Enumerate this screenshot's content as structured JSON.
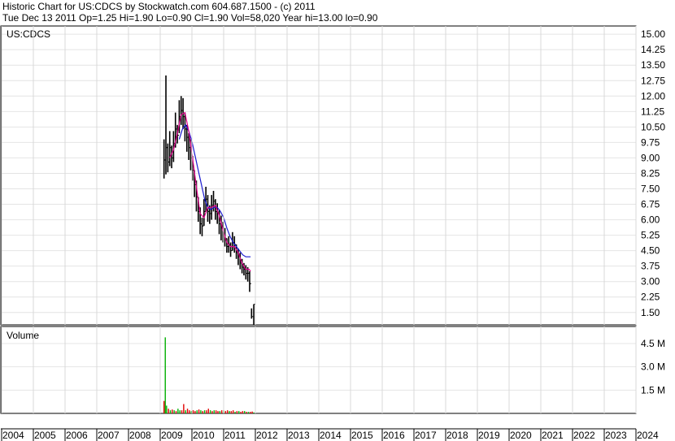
{
  "header": {
    "line1": "Historic Chart for US:CDCS by Stockwatch.com 604.687.1500 - (c) 2011",
    "line2": "Tue Dec 13 2011   Op=1.25  Hi=1.90  Lo=0.90  Cl=1.90  Vol=58,020  Year hi=13.00  lo=0.90"
  },
  "chart_data": [
    {
      "type": "line",
      "title": "US:CDCS",
      "ylim": [
        0.9,
        15.4
      ],
      "yticks": [
        "15.00",
        "14.25",
        "13.50",
        "12.75",
        "12.00",
        "11.25",
        "10.50",
        "9.75",
        "9.00",
        "8.25",
        "7.50",
        "6.75",
        "6.00",
        "5.25",
        "4.50",
        "3.75",
        "3.00",
        "2.25",
        "1.50"
      ],
      "x_start": 2004.0,
      "x_end": 2024.0,
      "xticks": [
        "2004",
        "2005",
        "2006",
        "2007",
        "2008",
        "2009",
        "2010",
        "2011",
        "2012",
        "2013",
        "2014",
        "2015",
        "2016",
        "2017",
        "2018",
        "2019",
        "2020",
        "2021",
        "2022",
        "2023",
        "2024"
      ],
      "colors": {
        "bars": "#000000",
        "ma_short": "#e0008c",
        "ma_long": "#1a1ad0"
      },
      "series": [
        {
          "kind": "price_bars",
          "x": [
            2009.12,
            2009.18,
            2009.24,
            2009.3,
            2009.36,
            2009.42,
            2009.48,
            2009.54,
            2009.6,
            2009.66,
            2009.72,
            2009.78,
            2009.84,
            2009.9,
            2009.96,
            2010.02,
            2010.08,
            2010.14,
            2010.2,
            2010.26,
            2010.32,
            2010.38,
            2010.44,
            2010.5,
            2010.56,
            2010.62,
            2010.68,
            2010.74,
            2010.8,
            2010.86,
            2010.92,
            2010.98,
            2011.04,
            2011.1,
            2011.16,
            2011.22,
            2011.28,
            2011.34,
            2011.4,
            2011.46,
            2011.52,
            2011.58,
            2011.64,
            2011.7,
            2011.76,
            2011.82,
            2011.88,
            2011.95
          ],
          "high": [
            9.9,
            13.0,
            9.7,
            10.3,
            9.6,
            10.3,
            11.2,
            10.6,
            11.8,
            12.0,
            11.9,
            11.2,
            10.6,
            10.2,
            9.9,
            9.1,
            8.4,
            7.9,
            7.1,
            6.6,
            6.1,
            7.0,
            7.6,
            7.2,
            6.7,
            7.2,
            7.4,
            7.0,
            6.8,
            6.5,
            6.2,
            5.9,
            5.6,
            5.1,
            5.2,
            4.9,
            5.4,
            5.2,
            4.8,
            4.6,
            4.4,
            4.1,
            3.9,
            3.8,
            3.7,
            3.5,
            1.7,
            1.9
          ],
          "low": [
            8.0,
            8.2,
            8.3,
            8.6,
            8.5,
            8.8,
            9.5,
            9.7,
            10.2,
            10.6,
            10.4,
            9.8,
            9.3,
            8.9,
            8.4,
            7.9,
            7.1,
            6.4,
            5.9,
            5.3,
            5.2,
            5.7,
            6.4,
            5.9,
            5.8,
            6.0,
            6.4,
            6.0,
            5.8,
            5.3,
            5.0,
            4.9,
            4.7,
            4.4,
            4.4,
            4.2,
            4.5,
            4.4,
            4.1,
            3.8,
            3.6,
            3.4,
            3.3,
            3.1,
            3.0,
            2.5,
            1.2,
            0.9
          ],
          "close": [
            8.9,
            9.5,
            8.8,
            9.5,
            9.0,
            9.7,
            10.4,
            10.1,
            11.0,
            11.3,
            11.0,
            10.4,
            10.0,
            9.5,
            9.0,
            8.4,
            7.7,
            7.1,
            6.4,
            5.8,
            5.7,
            6.4,
            7.0,
            6.4,
            6.3,
            6.7,
            6.9,
            6.4,
            6.3,
            5.8,
            5.6,
            5.3,
            5.1,
            4.7,
            4.8,
            4.5,
            4.9,
            4.8,
            4.4,
            4.2,
            3.9,
            3.7,
            3.6,
            3.4,
            3.4,
            2.9,
            1.3,
            1.9
          ]
        },
        {
          "name": "",
          "kind": "ma_short",
          "x": [
            2009.3,
            2009.42,
            2009.54,
            2009.66,
            2009.78,
            2009.9,
            2010.02,
            2010.14,
            2010.26,
            2010.38,
            2010.5,
            2010.62,
            2010.74,
            2010.86,
            2010.98,
            2011.1,
            2011.22,
            2011.34,
            2011.46,
            2011.58,
            2011.7,
            2011.8,
            2011.85
          ],
          "values": [
            9.0,
            9.4,
            10.2,
            11.1,
            11.2,
            10.3,
            9.0,
            7.6,
            6.3,
            6.1,
            6.6,
            6.6,
            6.7,
            6.2,
            5.5,
            4.9,
            4.7,
            4.7,
            4.4,
            3.9,
            3.6,
            3.6,
            3.5
          ]
        },
        {
          "name": "",
          "kind": "ma_long",
          "x": [
            2009.6,
            2009.7,
            2009.8,
            2009.9,
            2010.0,
            2010.1,
            2010.2,
            2010.3,
            2010.4,
            2010.5,
            2010.6,
            2010.7,
            2010.8,
            2010.9,
            2011.0,
            2011.1,
            2011.2,
            2011.3,
            2011.4,
            2011.5,
            2011.6,
            2011.7,
            2011.85
          ],
          "values": [
            9.9,
            10.4,
            10.6,
            10.3,
            9.8,
            9.1,
            8.4,
            7.7,
            7.0,
            6.6,
            6.5,
            6.6,
            6.6,
            6.4,
            6.1,
            5.6,
            5.2,
            4.9,
            4.7,
            4.5,
            4.3,
            4.2,
            4.2
          ]
        }
      ]
    },
    {
      "type": "bar",
      "title": "Volume",
      "ylim": [
        0,
        5.6
      ],
      "yticks": [
        "4.5 M",
        "3.0 M",
        "1.5 M"
      ],
      "ytick_values": [
        4.5,
        3.0,
        1.5
      ],
      "unit": "M",
      "colors": {
        "up": "#00b000",
        "down": "#e00000"
      },
      "x": [
        2009.12,
        2009.16,
        2009.2,
        2009.26,
        2009.32,
        2009.38,
        2009.44,
        2009.5,
        2009.56,
        2009.62,
        2009.68,
        2009.74,
        2009.8,
        2009.86,
        2009.92,
        2009.98,
        2010.04,
        2010.1,
        2010.16,
        2010.22,
        2010.28,
        2010.34,
        2010.4,
        2010.46,
        2010.52,
        2010.58,
        2010.64,
        2010.7,
        2010.76,
        2010.82,
        2010.88,
        2010.94,
        2011.0,
        2011.06,
        2011.12,
        2011.18,
        2011.24,
        2011.3,
        2011.36,
        2011.42,
        2011.48,
        2011.54,
        2011.6,
        2011.66,
        2011.72,
        2011.78,
        2011.84,
        2011.9,
        2011.95
      ],
      "values": [
        0.8,
        4.9,
        0.5,
        0.3,
        0.2,
        0.25,
        0.2,
        0.15,
        0.3,
        0.2,
        0.2,
        0.6,
        0.2,
        0.3,
        0.2,
        0.15,
        0.2,
        0.15,
        0.2,
        0.25,
        0.2,
        0.15,
        0.2,
        0.2,
        0.3,
        0.2,
        0.15,
        0.2,
        0.2,
        0.15,
        0.15,
        0.2,
        0.2,
        0.15,
        0.2,
        0.15,
        0.15,
        0.2,
        0.1,
        0.15,
        0.15,
        0.1,
        0.15,
        0.15,
        0.1,
        0.1,
        0.1,
        0.12,
        0.06
      ],
      "direction": [
        "down",
        "up",
        "up",
        "down",
        "up",
        "down",
        "up",
        "down",
        "up",
        "up",
        "down",
        "down",
        "up",
        "down",
        "down",
        "up",
        "down",
        "down",
        "up",
        "down",
        "up",
        "down",
        "up",
        "down",
        "down",
        "up",
        "down",
        "up",
        "down",
        "down",
        "up",
        "down",
        "up",
        "down",
        "down",
        "up",
        "down",
        "down",
        "up",
        "down",
        "up",
        "down",
        "down",
        "up",
        "down",
        "up",
        "down",
        "down",
        "up"
      ]
    }
  ]
}
